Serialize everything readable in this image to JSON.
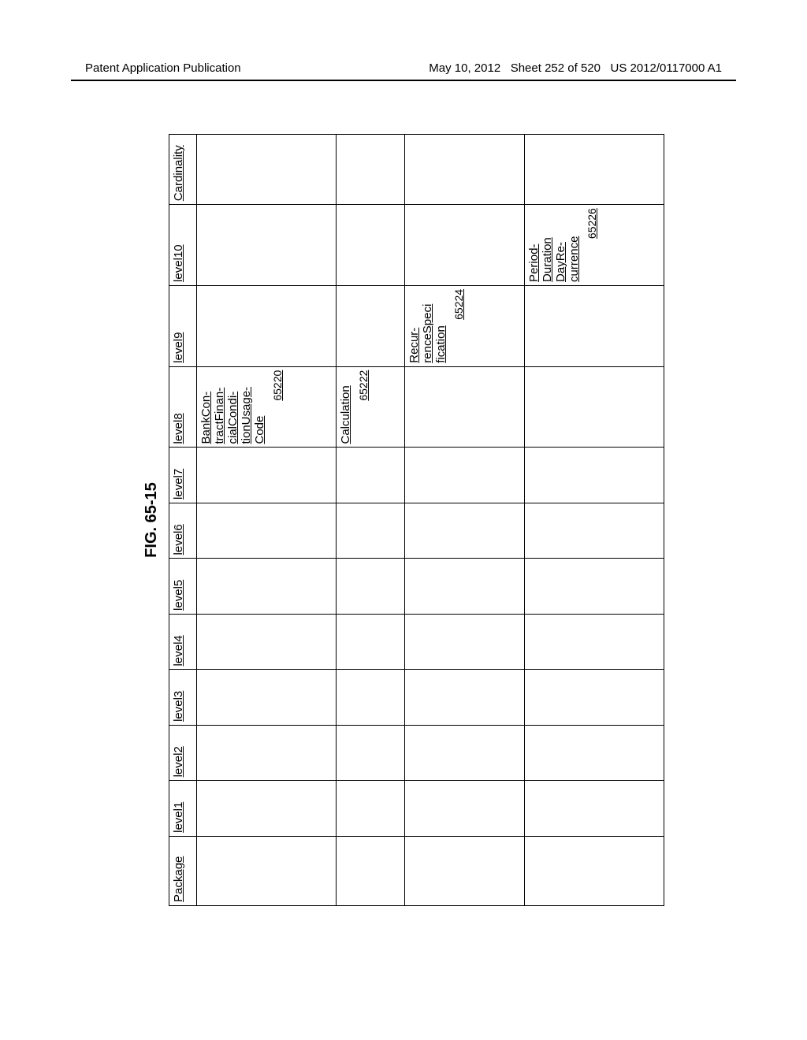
{
  "header": {
    "left": "Patent Application Publication",
    "date": "May 10, 2012",
    "sheet": "Sheet 252 of 520",
    "pubno": "US 2012/0117000 A1"
  },
  "figure_label": "FIG. 65-15",
  "columns": [
    "Package",
    "level1",
    "level2",
    "level3",
    "level4",
    "level5",
    "level6",
    "level7",
    "level8",
    "level9",
    "level10",
    "Cardinality"
  ],
  "rows": [
    {
      "level8": {
        "label": "BankCon-\ntractFinan-\ncialCondi-\ntionUsage-\nCode",
        "ref": "65220"
      }
    },
    {
      "level8": {
        "label": "Calculation",
        "ref": "65222"
      }
    },
    {
      "level9": {
        "label": "Recur-\nrenceSpeci\nfication",
        "ref": "65224"
      }
    },
    {
      "level10": {
        "label": "Period-\nDuration\nDayRe-\ncurrence",
        "ref": "65226"
      }
    }
  ]
}
